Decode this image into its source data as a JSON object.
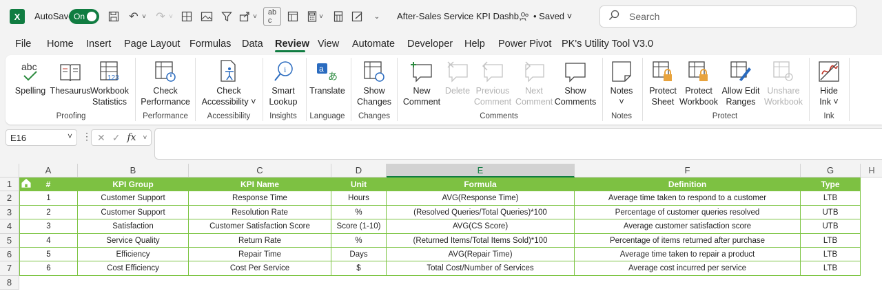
{
  "titlebar": {
    "logo": "X",
    "autosave_label": "AutoSave",
    "autosave_state": "On",
    "doc_title": "After-Sales Service KPI Dashb...",
    "saved": "• Saved",
    "search_placeholder": "Search"
  },
  "menu": [
    "File",
    "Home",
    "Insert",
    "Page Layout",
    "Formulas",
    "Data",
    "Review",
    "View",
    "Automate",
    "Developer",
    "Help",
    "Power Pivot",
    "PK's Utility Tool V3.0"
  ],
  "menu_active": "Review",
  "ribbon": {
    "buttons": [
      {
        "l1": "Spelling",
        "l2": "",
        "icon": "spelling-icon",
        "disabled": false
      },
      {
        "l1": "Thesaurus",
        "l2": "",
        "icon": "thesaurus-icon",
        "disabled": false
      },
      {
        "l1": "Workbook",
        "l2": "Statistics",
        "icon": "workbook-statistics-icon",
        "disabled": false
      },
      {
        "l1": "Check",
        "l2": "Performance",
        "icon": "check-performance-icon",
        "disabled": false
      },
      {
        "l1": "Check",
        "l2": "Accessibility ˅",
        "icon": "check-accessibility-icon",
        "disabled": false
      },
      {
        "l1": "Smart",
        "l2": "Lookup",
        "icon": "smart-lookup-icon",
        "disabled": false
      },
      {
        "l1": "Translate",
        "l2": "",
        "icon": "translate-icon",
        "disabled": false
      },
      {
        "l1": "Show",
        "l2": "Changes",
        "icon": "show-changes-icon",
        "disabled": false
      },
      {
        "l1": "New",
        "l2": "Comment",
        "icon": "new-comment-icon",
        "disabled": false
      },
      {
        "l1": "Delete",
        "l2": "",
        "icon": "delete-comment-icon",
        "disabled": true
      },
      {
        "l1": "Previous",
        "l2": "Comment",
        "icon": "previous-comment-icon",
        "disabled": true
      },
      {
        "l1": "Next",
        "l2": "Comment",
        "icon": "next-comment-icon",
        "disabled": true
      },
      {
        "l1": "Show",
        "l2": "Comments",
        "icon": "show-comments-icon",
        "disabled": false
      },
      {
        "l1": "Notes",
        "l2": "˅",
        "icon": "notes-icon",
        "disabled": false
      },
      {
        "l1": "Protect",
        "l2": "Sheet",
        "icon": "protect-sheet-icon",
        "disabled": false
      },
      {
        "l1": "Protect",
        "l2": "Workbook",
        "icon": "protect-workbook-icon",
        "disabled": false
      },
      {
        "l1": "Allow Edit",
        "l2": "Ranges",
        "icon": "allow-edit-ranges-icon",
        "disabled": false
      },
      {
        "l1": "Unshare",
        "l2": "Workbook",
        "icon": "unshare-workbook-icon",
        "disabled": true
      },
      {
        "l1": "Hide",
        "l2": "Ink ˅",
        "icon": "hide-ink-icon",
        "disabled": false
      }
    ],
    "groups": [
      "Proofing",
      "Performance",
      "Accessibility",
      "Insights",
      "Language",
      "Changes",
      "Comments",
      "Notes",
      "Protect",
      "Ink"
    ]
  },
  "formula_bar": {
    "name_box": "E16",
    "fx": "fx",
    "value": ""
  },
  "grid": {
    "columns": [
      "A",
      "B",
      "C",
      "D",
      "E",
      "F",
      "G"
    ],
    "selected_column": "E",
    "rows": [
      "1",
      "2",
      "3",
      "4",
      "5",
      "6",
      "7",
      "8"
    ],
    "header": [
      "#",
      "KPI Group",
      "KPI Name",
      "Unit",
      "Formula",
      "Definition",
      "Type"
    ],
    "data": [
      [
        "1",
        "Customer Support",
        "Response Time",
        "Hours",
        "AVG(Response Time)",
        "Average time taken to respond to a customer",
        "LTB"
      ],
      [
        "2",
        "Customer Support",
        "Resolution Rate",
        "%",
        "(Resolved Queries/Total Queries)*100",
        "Percentage of customer queries resolved",
        "UTB"
      ],
      [
        "3",
        "Satisfaction",
        "Customer Satisfaction Score",
        "Score (1-10)",
        "AVG(CS Score)",
        "Average customer satisfaction score",
        "UTB"
      ],
      [
        "4",
        "Service Quality",
        "Return Rate",
        "%",
        "(Returned Items/Total Items Sold)*100",
        "Percentage of items returned after purchase",
        "LTB"
      ],
      [
        "5",
        "Efficiency",
        "Repair Time",
        "Days",
        "AVG(Repair Time)",
        "Average time taken to repair a product",
        "LTB"
      ],
      [
        "6",
        "Cost Efficiency",
        "Cost Per Service",
        "$",
        "Total Cost/Number of Services",
        "Average cost incurred per service",
        "LTB"
      ]
    ]
  },
  "colors": {
    "accent": "#107c41",
    "table_header": "#7dc142",
    "table_border": "#7cc442"
  }
}
